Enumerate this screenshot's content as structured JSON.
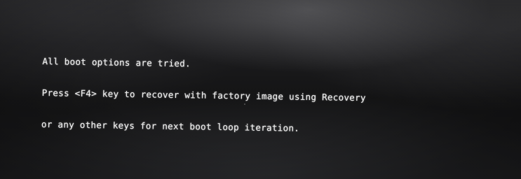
{
  "boot_message": {
    "line1": "All boot options are tried.",
    "line2": "Press <F4> key to recover with factory image using Recovery",
    "line3": "or any other keys for next boot loop iteration."
  }
}
